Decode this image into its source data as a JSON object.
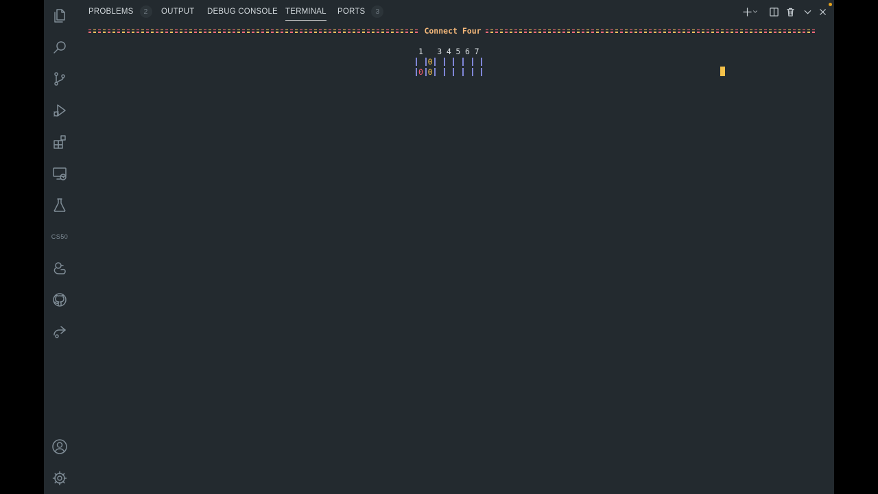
{
  "activity_bar": {
    "items": [
      {
        "icon": "files-icon"
      },
      {
        "icon": "search-icon"
      },
      {
        "icon": "source-control-icon"
      },
      {
        "icon": "run-debug-icon"
      },
      {
        "icon": "extensions-icon"
      },
      {
        "icon": "remote-explorer-icon"
      },
      {
        "icon": "testing-icon"
      },
      {
        "label": "CS50"
      },
      {
        "icon": "duck-icon"
      },
      {
        "icon": "github-icon"
      },
      {
        "icon": "share-icon"
      }
    ],
    "bottom": [
      {
        "icon": "account-icon"
      },
      {
        "icon": "settings-gear-icon"
      }
    ]
  },
  "panel": {
    "tabs": [
      {
        "label": "PROBLEMS",
        "count": "2"
      },
      {
        "label": "OUTPUT"
      },
      {
        "label": "DEBUG CONSOLE"
      },
      {
        "label": "TERMINAL",
        "active": true
      },
      {
        "label": "PORTS",
        "count": "3"
      }
    ],
    "toolbar": [
      "new-terminal-icon",
      "dropdown-icon",
      "split-terminal-icon",
      "kill-terminal-icon",
      "maximize-panel-icon",
      "close-panel-icon"
    ]
  },
  "terminal": {
    "title": "Connect Four",
    "column_numbers": [
      "1",
      "",
      "3",
      "4",
      "5",
      "6",
      "7"
    ],
    "rows": [
      [
        "",
        "0",
        "",
        "",
        "",
        "",
        ""
      ],
      [
        "0",
        "0",
        "",
        "",
        "",
        "",
        ""
      ]
    ],
    "colors": {
      "banner_rule_a": "#ff6a7a",
      "banner_rule_b": "#f0c35f",
      "banner_title": "#f5b87a",
      "board_bar": "#7f86d6",
      "chip_red": "#ff5d73",
      "chip_yellow": "#f5c14a",
      "cursor": "#f5c14a"
    }
  }
}
